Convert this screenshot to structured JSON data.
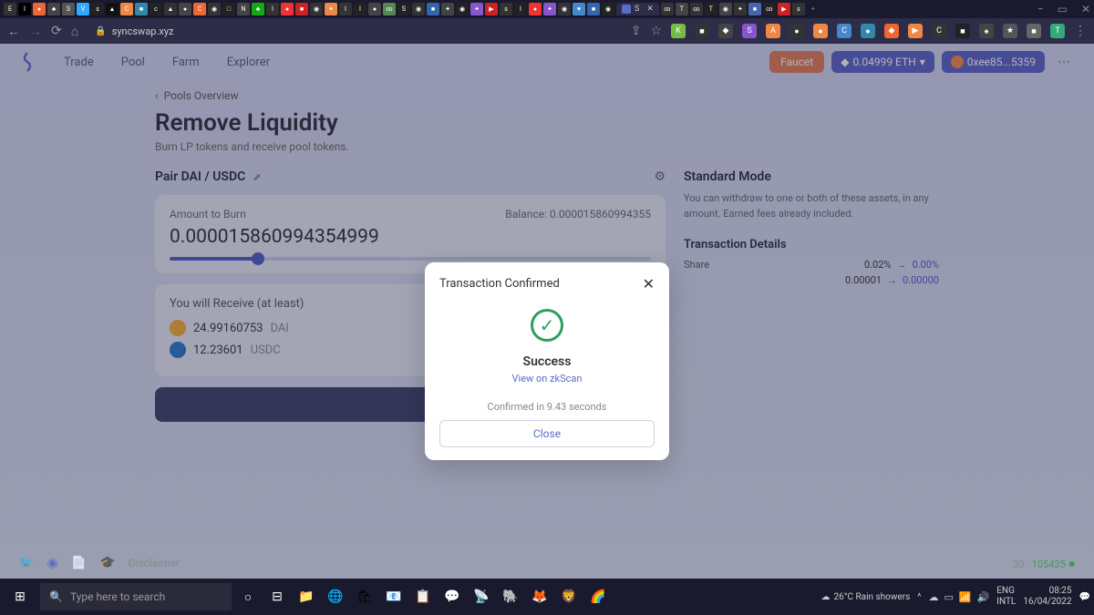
{
  "browser": {
    "active_tab": "S",
    "url": "syncswap.xyz",
    "window_controls": {
      "min": "−",
      "max": "▭",
      "close": "✕"
    }
  },
  "header": {
    "nav": {
      "trade": "Trade",
      "pool": "Pool",
      "farm": "Farm",
      "explorer": "Explorer"
    },
    "faucet": "Faucet",
    "eth_balance": "0.04999 ETH",
    "address": "0xee85...5359"
  },
  "page": {
    "back": "Pools Overview",
    "title": "Remove Liquidity",
    "subtitle": "Burn LP tokens and receive pool tokens.",
    "pair": "Pair DAI / USDC",
    "burn": {
      "label": "Amount to Burn",
      "balance_label": "Balance:",
      "balance": "0.000015860994355",
      "amount": "0.000015860994354999"
    },
    "receive": {
      "label": "You will Receive (at least)",
      "dai_amt": "24.99160753",
      "dai_sym": "DAI",
      "usdc_amt": "12.23601",
      "usdc_sym": "USDC"
    },
    "mode": {
      "title": "Standard Mode",
      "desc": "You can withdraw to one or both of these assets, in any amount. Earned fees already included."
    },
    "details": {
      "title": "Transaction Details",
      "share_label": "Share",
      "share_from": "0.02%",
      "share_to": "0.00%",
      "amt_from": "0.00001",
      "amt_to": "0.00000"
    }
  },
  "modal": {
    "title": "Transaction Confirmed",
    "success": "Success",
    "scan_link": "View on zkScan",
    "confirmed": "Confirmed in 9.43 seconds",
    "close": "Close"
  },
  "footer": {
    "disclaimer": "Disclaimer",
    "num1": "30",
    "block": "105435"
  },
  "taskbar": {
    "search": "Type here to search",
    "weather": "26°C Rain showers",
    "lang1": "ENG",
    "lang2": "INTL",
    "time": "08:25",
    "date": "16/04/2022"
  }
}
